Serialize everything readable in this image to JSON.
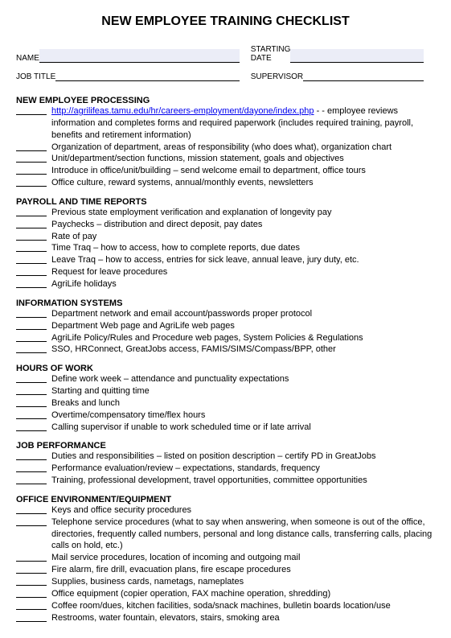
{
  "title": "NEW EMPLOYEE TRAINING CHECKLIST",
  "fields": {
    "name_label": "NAME",
    "startdate_label": "STARTING\nDATE",
    "jobtitle_label": "JOB TITLE",
    "supervisor_label": "SUPERVISOR"
  },
  "sections": [
    {
      "head": "NEW EMPLOYEE PROCESSING",
      "items": [
        {
          "link": "http://agrilifeas.tamu.edu/hr/careers-employment/dayone/index.php",
          "after": " - - employee reviews information and completes forms and required paperwork (includes required training, payroll, benefits and retirement information)"
        },
        {
          "text": "Organization of department, areas of responsibility (who does what), organization chart"
        },
        {
          "text": "Unit/department/section functions, mission statement, goals and objectives"
        },
        {
          "text": "Introduce in office/unit/building – send welcome email to department, office tours"
        },
        {
          "text": "Office culture, reward systems, annual/monthly events, newsletters"
        }
      ]
    },
    {
      "head": "PAYROLL AND TIME REPORTS",
      "items": [
        {
          "text": "Previous state employment verification and explanation of longevity pay"
        },
        {
          "text": "Paychecks – distribution and direct deposit, pay dates"
        },
        {
          "text": "Rate of pay"
        },
        {
          "text": "Time Traq – how to access, how to complete reports, due dates"
        },
        {
          "text": "Leave Traq – how to access, entries for sick leave, annual leave, jury duty, etc."
        },
        {
          "text": "Request for leave procedures"
        },
        {
          "text": "AgriLife holidays"
        }
      ]
    },
    {
      "head": "INFORMATION SYSTEMS",
      "items": [
        {
          "text": "Department network and email account/passwords proper protocol"
        },
        {
          "text": "Department Web page and AgriLife web pages"
        },
        {
          "text": "AgriLife Policy/Rules and Procedure web pages, System Policies & Regulations"
        },
        {
          "text": "SSO, HRConnect, GreatJobs access, FAMIS/SIMS/Compass/BPP, other"
        }
      ]
    },
    {
      "head": "HOURS OF WORK",
      "items": [
        {
          "text": "Define work week – attendance and punctuality expectations"
        },
        {
          "text": "Starting and quitting time"
        },
        {
          "text": "Breaks and lunch"
        },
        {
          "text": "Overtime/compensatory time/flex hours"
        },
        {
          "text": "Calling supervisor if unable to work scheduled time or if late arrival"
        }
      ]
    },
    {
      "head": "JOB PERFORMANCE",
      "items": [
        {
          "text": "Duties and responsibilities – listed on position description – certify PD in GreatJobs"
        },
        {
          "text": "Performance evaluation/review – expectations, standards, frequency"
        },
        {
          "text": "Training, professional development, travel opportunities, committee opportunities"
        }
      ]
    },
    {
      "head": "OFFICE ENVIRONMENT/EQUIPMENT",
      "items": [
        {
          "text": "Keys and office security procedures"
        },
        {
          "text": "Telephone service procedures (what to say when answering, when someone is out of the office, directories, frequently called numbers, personal and long distance calls, transferring calls, placing calls on hold, etc.)"
        },
        {
          "text": "Mail service procedures, location of incoming and outgoing mail"
        },
        {
          "text": "Fire alarm, fire drill, evacuation plans, fire escape procedures"
        },
        {
          "text": "Supplies, business cards, nametags, nameplates"
        },
        {
          "text": "Office equipment (copier operation, FAX machine operation, shredding)"
        },
        {
          "text": "Coffee room/dues, kitchen facilities, soda/snack machines, bulletin boards location/use"
        },
        {
          "text": "Restrooms, water fountain, elevators, stairs, smoking area"
        }
      ]
    }
  ]
}
